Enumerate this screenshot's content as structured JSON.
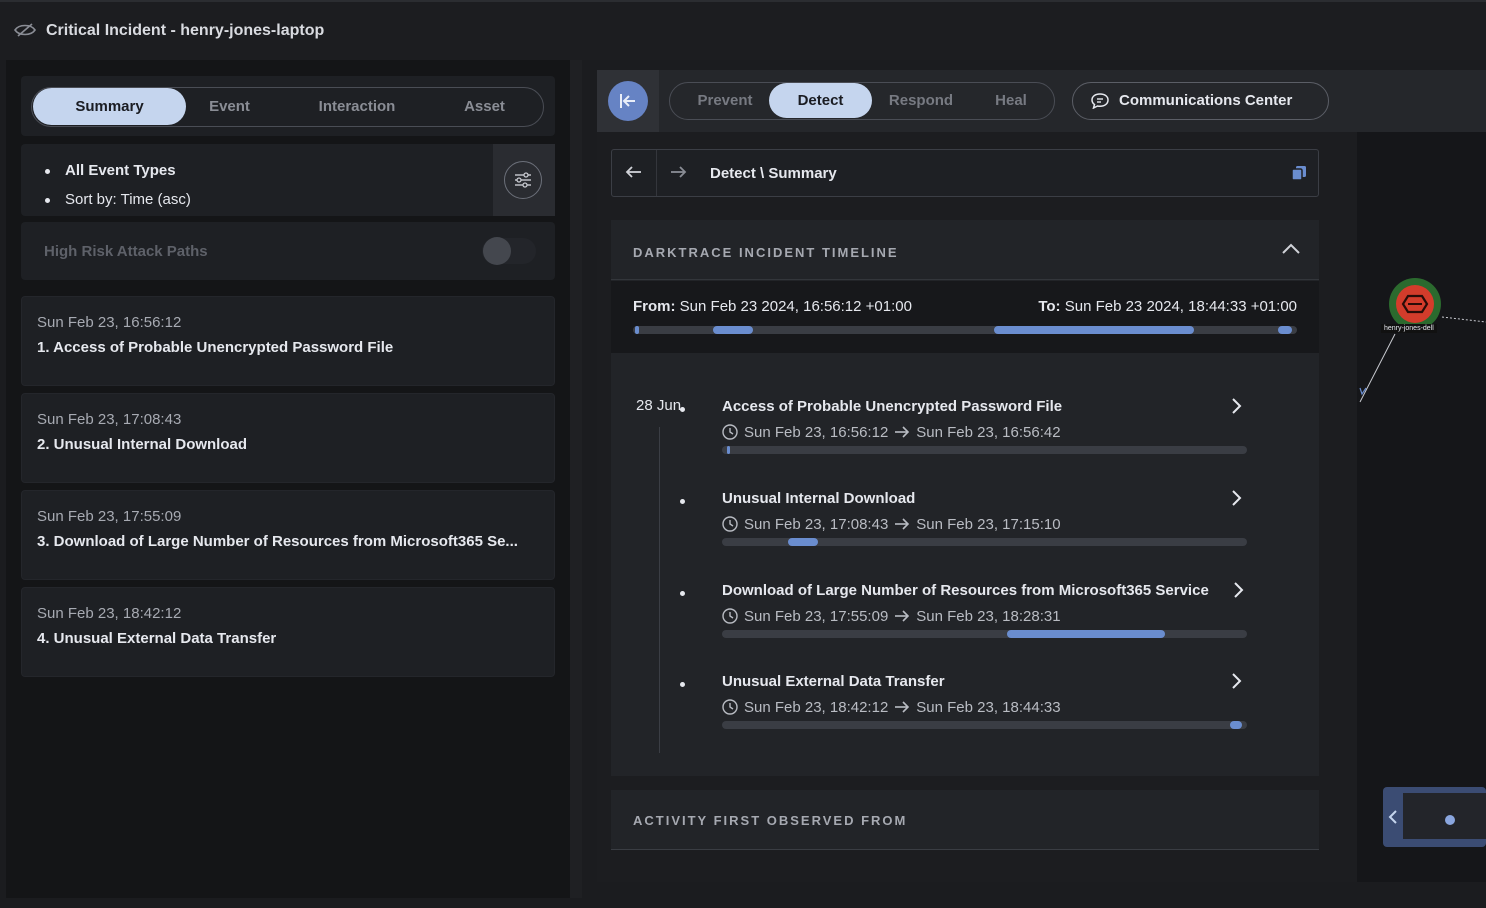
{
  "window": {
    "title": "Critical Incident - henry-jones-laptop"
  },
  "left_panel": {
    "tabs": [
      {
        "label": "Summary",
        "active": true
      },
      {
        "label": "Event",
        "active": false
      },
      {
        "label": "Interaction",
        "active": false
      },
      {
        "label": "Asset",
        "active": false
      }
    ],
    "filters": {
      "event_types": "All Event Types",
      "sort": "Sort by: Time (asc)"
    },
    "high_risk": {
      "label": "High Risk Attack Paths",
      "enabled": false
    },
    "events": [
      {
        "time": "Sun Feb 23, 16:56:12",
        "name": "1. Access of Probable Unencrypted Password File"
      },
      {
        "time": "Sun Feb 23, 17:08:43",
        "name": "2. Unusual Internal Download"
      },
      {
        "time": "Sun Feb 23, 17:55:09",
        "name": "3. Download of Large Number of Resources from Microsoft365 Se..."
      },
      {
        "time": "Sun Feb 23, 18:42:12",
        "name": "4. Unusual External Data Transfer"
      }
    ]
  },
  "right_panel": {
    "stages": [
      {
        "label": "Prevent",
        "active": false
      },
      {
        "label": "Detect",
        "active": true
      },
      {
        "label": "Respond",
        "active": false
      },
      {
        "label": "Heal",
        "active": false
      }
    ],
    "communications_label": "Communications Center",
    "breadcrumb": "Detect \\ Summary",
    "timeline": {
      "title": "DARKTRACE INCIDENT TIMELINE",
      "from_label": "From:",
      "from_value": "Sun Feb 23 2024, 16:56:12 +01:00",
      "to_label": "To:",
      "to_value": "Sun Feb 23 2024, 18:44:33 +01:00",
      "date_label": "28 Jun",
      "items": [
        {
          "name": "Access of Probable Unencrypted Password File",
          "start": "Sun Feb 23, 16:56:12",
          "end": "Sun Feb 23, 16:56:42"
        },
        {
          "name": "Unusual Internal Download",
          "start": "Sun Feb 23, 17:08:43",
          "end": "Sun Feb 23, 17:15:10"
        },
        {
          "name": "Download of Large Number of Resources from Microsoft365 Service",
          "start": "Sun Feb 23, 17:55:09",
          "end": "Sun Feb 23, 18:28:31"
        },
        {
          "name": "Unusual External Data Transfer",
          "start": "Sun Feb 23, 18:42:12",
          "end": "Sun Feb 23, 18:44:33"
        }
      ]
    },
    "second_section_title": "ACTIVITY FIRST OBSERVED FROM",
    "graph": {
      "node_label": "henry-jones-dell"
    }
  },
  "colors": {
    "accent": "#6a8dcf",
    "active_tab": "#c5d5ee",
    "node_red": "#d43c2b",
    "node_green": "#2b6a2e"
  }
}
